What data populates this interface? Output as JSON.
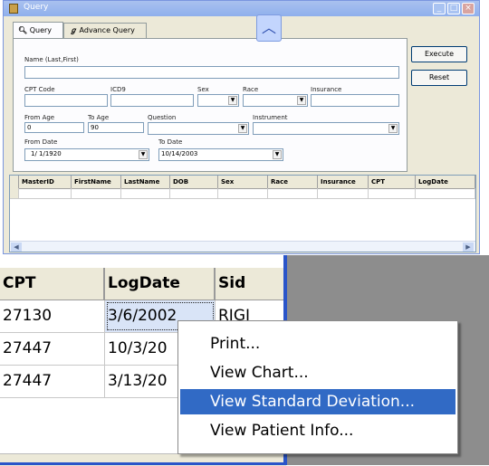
{
  "window": {
    "title": "Query",
    "tabs": [
      "Query",
      "Advance Query"
    ],
    "buttons": {
      "execute": "Execute",
      "reset": "Reset"
    }
  },
  "form": {
    "name_label": "Name (Last,First)",
    "name_value": "",
    "cpt_label": "CPT Code",
    "icd9_label": "ICD9",
    "sex_label": "Sex",
    "race_label": "Race",
    "insurance_label": "Insurance",
    "from_age_label": "From Age",
    "from_age_value": "0",
    "to_age_label": "To Age",
    "to_age_value": "90",
    "question_label": "Question",
    "instrument_label": "Instrument",
    "from_date_label": "From Date",
    "from_date_value": "1/ 1/1920",
    "to_date_label": "To Date",
    "to_date_value": "10/14/2003"
  },
  "grid": {
    "columns": [
      "MasterID",
      "FirstName",
      "LastName",
      "DOB",
      "Sex",
      "Race",
      "Insurance",
      "CPT",
      "LogDate"
    ]
  },
  "zoom": {
    "columns": [
      "CPT",
      "LogDate",
      "Sid"
    ],
    "rows": [
      [
        "27130",
        "3/6/2002",
        "RIGI"
      ],
      [
        "27447",
        "10/3/20",
        ""
      ],
      [
        "27447",
        "3/13/20",
        ""
      ]
    ]
  },
  "context_menu": {
    "items": [
      "Print...",
      "View Chart...",
      "View Standard Deviation...",
      "View Patient Info..."
    ],
    "highlighted_index": 2
  },
  "colors": {
    "highlight": "#316ac5",
    "titlebar": "#a9c1ef"
  }
}
